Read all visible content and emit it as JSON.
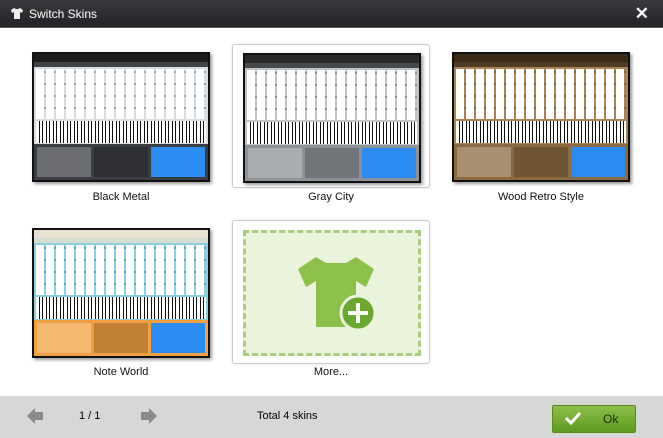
{
  "window": {
    "title": "Switch Skins",
    "close_icon": "close-icon"
  },
  "skins": [
    {
      "label": "Black Metal",
      "selected": false,
      "colors": {
        "frame": "#1c1c1c",
        "keys": "#d8dde2",
        "panel": "#3a3d42"
      }
    },
    {
      "label": "Gray City",
      "selected": true,
      "colors": {
        "frame": "#2a2a2a",
        "keys": "#bfc3c6",
        "panel": "#8e9296"
      }
    },
    {
      "label": "Wood Retro Style",
      "selected": false,
      "colors": {
        "frame": "#3a2a18",
        "keys": "#a88456",
        "panel": "#8a6a40"
      }
    },
    {
      "label": "Note World",
      "selected": false,
      "colors": {
        "frame": "#e8e0d0",
        "keys": "#8ccfe0",
        "panel": "#f0a040"
      }
    }
  ],
  "more": {
    "label": "More...",
    "icon": "tshirt-add-icon",
    "color": "#8cc04a"
  },
  "footer": {
    "page": "1 / 1",
    "total": "Total 4 skins",
    "ok_label": "Ok"
  }
}
